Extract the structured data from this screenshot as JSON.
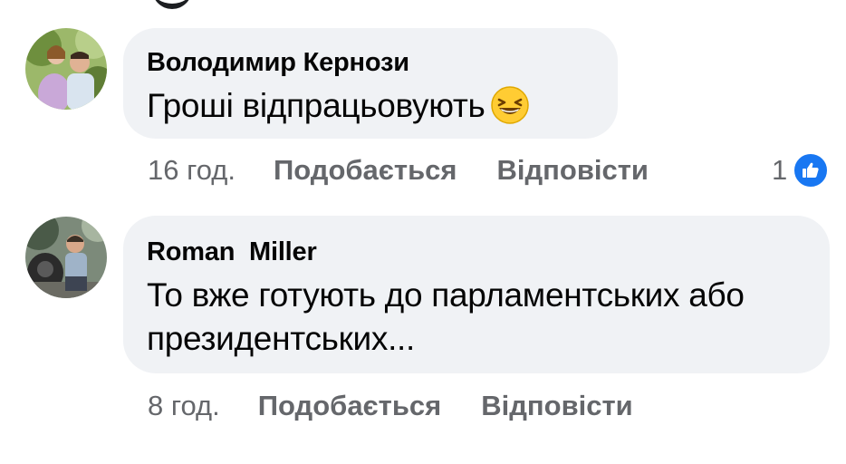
{
  "comments": [
    {
      "author": "Володимир Кернози",
      "text": "Гроші відпрацьовують",
      "emoji": "grinning-squinting-face",
      "time": "16 год.",
      "like_label": "Подобається",
      "reply_label": "Відповісти",
      "reaction_count": "1",
      "reaction_icon": "like-icon"
    },
    {
      "author": "Roman  Miller",
      "text": "То вже готують до парламентських або президентських...",
      "time": "8 год.",
      "like_label": "Подобається",
      "reply_label": "Відповісти"
    }
  ],
  "colors": {
    "bubble": "#f0f2f5",
    "meta_text": "#65676b",
    "like_badge": "#1877f2",
    "text": "#050505"
  }
}
